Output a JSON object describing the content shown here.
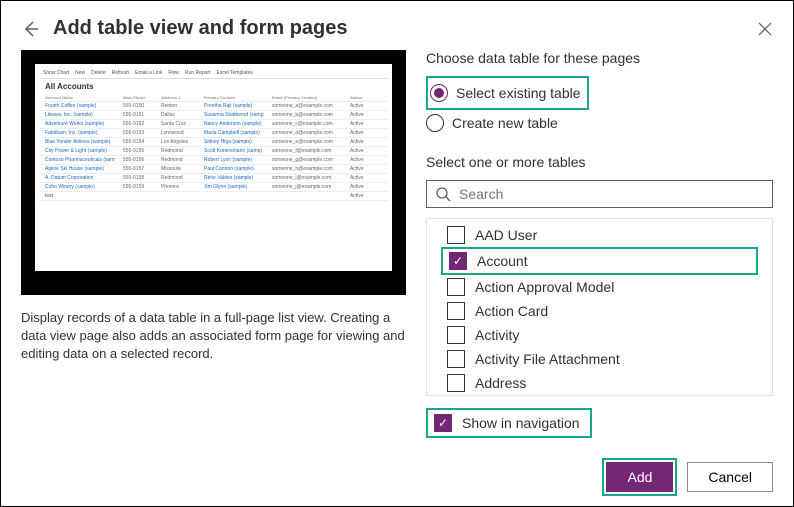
{
  "header": {
    "title": "Add table view and form pages"
  },
  "left": {
    "description": "Display records of a data table in a full-page list view. Creating a data view page also adds an associated form page for viewing and editing data on a selected record.",
    "preview": {
      "heading": "All Accounts",
      "toolbar": [
        "Show Chart",
        "New",
        "Delete",
        "Refresh",
        "Email a Link",
        "Flow",
        "Run Report",
        "Excel Templates"
      ],
      "header_row": [
        "Account Name",
        "Main Phone",
        "Address 1",
        "Primary Contact",
        "Email (Primary Contact)",
        "Status"
      ],
      "rows": [
        [
          "Fourth Coffee (sample)",
          "555-0150",
          "Renton",
          "Preetha Raji (sample)",
          "someone_a@example.com",
          "Active"
        ],
        [
          "Litware, Inc. (sample)",
          "555-0151",
          "Dallas",
          "Susanna Stubberod (samp)",
          "someone_b@example.com",
          "Active"
        ],
        [
          "Adventure Works (sample)",
          "555-0152",
          "Santa Cruz",
          "Nancy Anderson (sample)",
          "someone_c@example.com",
          "Active"
        ],
        [
          "Fabrikam, Inc. (sample)",
          "555-0153",
          "Lynnwood",
          "Maria Campbell (sample)",
          "someone_d@example.com",
          "Active"
        ],
        [
          "Blue Yonder Airlines (sample)",
          "555-0154",
          "Los Angeles",
          "Sidney Higa (sample)",
          "someone_e@example.com",
          "Active"
        ],
        [
          "City Power & Light (sample)",
          "555-0155",
          "Redmond",
          "Scott Konersmann (samp)",
          "someone_f@example.com",
          "Active"
        ],
        [
          "Contoso Pharmaceuticals (sample)",
          "555-0156",
          "Redmond",
          "Robert Lyon (sample)",
          "someone_g@example.com",
          "Active"
        ],
        [
          "Alpine Ski House (sample)",
          "555-0157",
          "Missoula",
          "Paul Cannon (sample)",
          "someone_h@example.com",
          "Active"
        ],
        [
          "A. Datum Corporation",
          "555-0158",
          "Redmond",
          "Rene Valdes (sample)",
          "someone_i@example.com",
          "Active"
        ],
        [
          "Coho Winery (sample)",
          "555-0159",
          "Phoenix",
          "Jim Glynn (sample)",
          "someone_j@example.com",
          "Active"
        ],
        [
          "test",
          "",
          "",
          "",
          "",
          "Active"
        ]
      ]
    }
  },
  "right": {
    "choose_label": "Choose data table for these pages",
    "radio_existing": "Select existing table",
    "radio_new": "Create new table",
    "select_label": "Select one or more tables",
    "search_placeholder": "Search",
    "tables": [
      {
        "label": "AAD User",
        "checked": false
      },
      {
        "label": "Account",
        "checked": true
      },
      {
        "label": "Action Approval Model",
        "checked": false
      },
      {
        "label": "Action Card",
        "checked": false
      },
      {
        "label": "Activity",
        "checked": false
      },
      {
        "label": "Activity File Attachment",
        "checked": false
      },
      {
        "label": "Address",
        "checked": false
      }
    ],
    "show_nav_label": "Show in navigation"
  },
  "footer": {
    "add": "Add",
    "cancel": "Cancel"
  }
}
